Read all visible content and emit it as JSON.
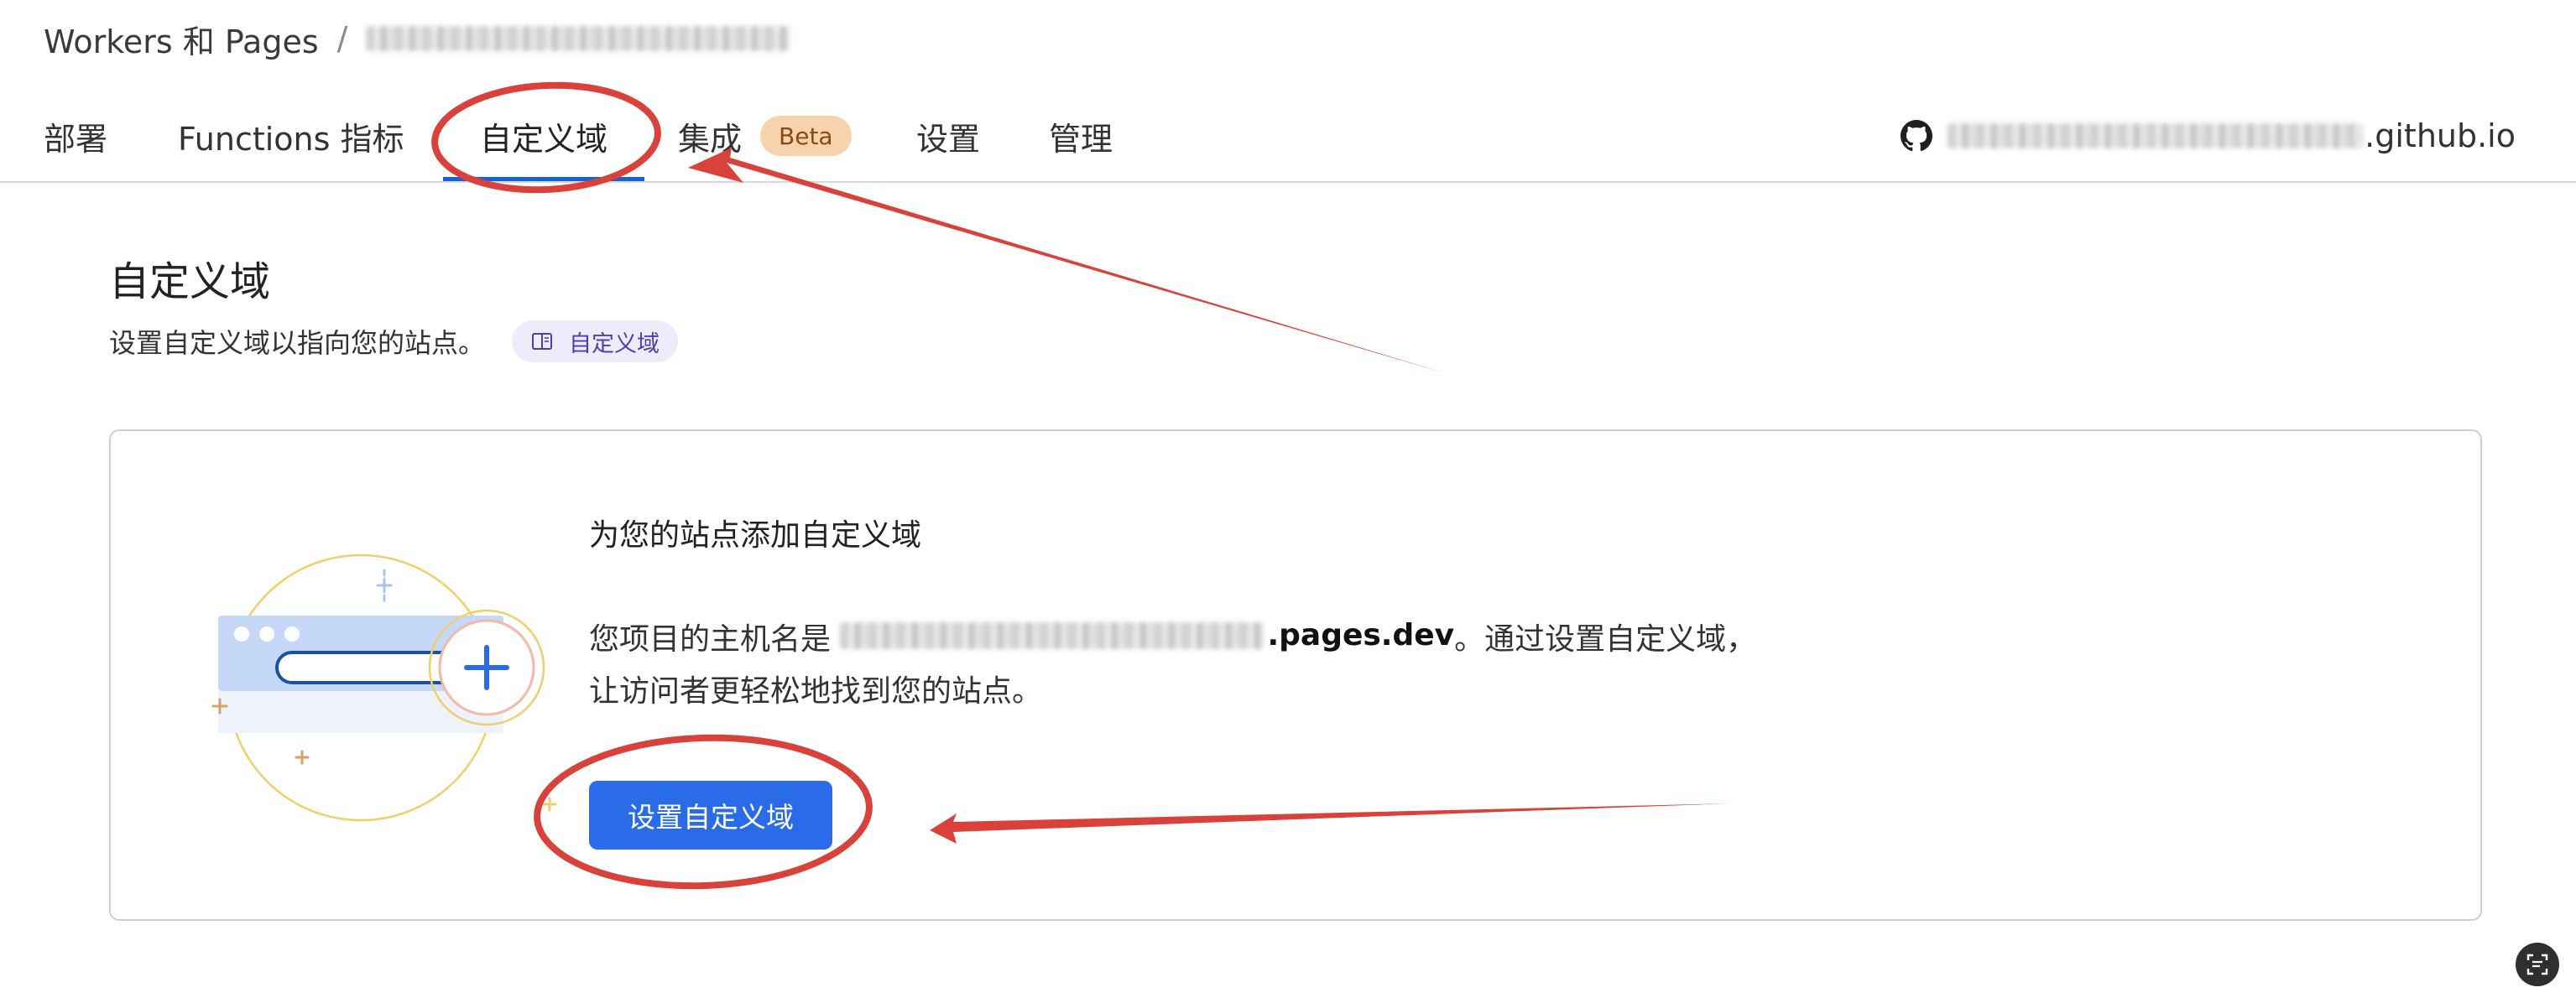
{
  "breadcrumb": {
    "root": "Workers 和 Pages",
    "separator": "/",
    "project": "[blurred project name]"
  },
  "tabs": [
    {
      "label": "部署"
    },
    {
      "label": "Functions 指标"
    },
    {
      "label": "自定义域"
    },
    {
      "label": "集成",
      "badge": "Beta"
    },
    {
      "label": "设置"
    },
    {
      "label": "管理"
    }
  ],
  "active_tab": "自定义域",
  "github": {
    "icon": "github-icon",
    "domain_suffix": ".github.io"
  },
  "section": {
    "title": "自定义域",
    "description": "设置自定义域以指向您的站点。",
    "doc_link": "自定义域"
  },
  "card": {
    "heading": "为您的站点添加自定义域",
    "text_prefix": "您项目的主机名是 ",
    "hostname_suffix": ".pages.dev",
    "text_suffix": "。通过设置自定义域，让访问者更轻松地找到您的站点。",
    "button_label": "设置自定义域"
  },
  "colors": {
    "primary": "#2a6ce8",
    "tab_underline": "#1463d4",
    "beta_badge": "#f6d3ad",
    "annotation": "#d9413b"
  }
}
